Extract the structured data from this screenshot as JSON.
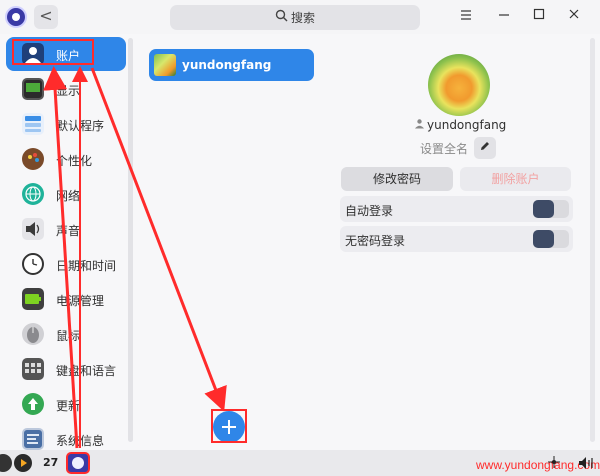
{
  "titlebar": {
    "back_label": "<",
    "search_label": "搜索",
    "window_controls": [
      "menu-icon",
      "minimize-icon",
      "maximize-icon",
      "close-icon"
    ]
  },
  "sidebar": {
    "items": [
      {
        "label": "账户",
        "icon": "user-icon",
        "active": true
      },
      {
        "label": "显示",
        "icon": "display-icon"
      },
      {
        "label": "默认程序",
        "icon": "default-apps-icon"
      },
      {
        "label": "个性化",
        "icon": "personalization-icon"
      },
      {
        "label": "网络",
        "icon": "network-icon"
      },
      {
        "label": "声音",
        "icon": "sound-icon"
      },
      {
        "label": "日期和时间",
        "icon": "clock-icon"
      },
      {
        "label": "电源管理",
        "icon": "battery-icon"
      },
      {
        "label": "鼠标",
        "icon": "mouse-icon"
      },
      {
        "label": "键盘和语言",
        "icon": "keyboard-icon"
      },
      {
        "label": "更新",
        "icon": "update-icon"
      },
      {
        "label": "系统信息",
        "icon": "system-info-icon"
      }
    ]
  },
  "accounts": {
    "list": [
      {
        "name": "yundongfang"
      }
    ],
    "add_label": "+"
  },
  "detail": {
    "username": "yundongfang",
    "set_fullname_label": "设置全名",
    "change_password_label": "修改密码",
    "delete_account_label": "删除账户",
    "options": [
      {
        "label": "自动登录",
        "enabled": false
      },
      {
        "label": "无密码登录",
        "enabled": false
      }
    ]
  },
  "taskbar": {
    "date_number": "27",
    "watermark": "www.yundongfang.com"
  },
  "colors": {
    "accent": "#2f86e8",
    "annotation": "#ff2b2b",
    "toggle_knob": "#3e4b66",
    "delete_text": "#f2a2a2"
  }
}
